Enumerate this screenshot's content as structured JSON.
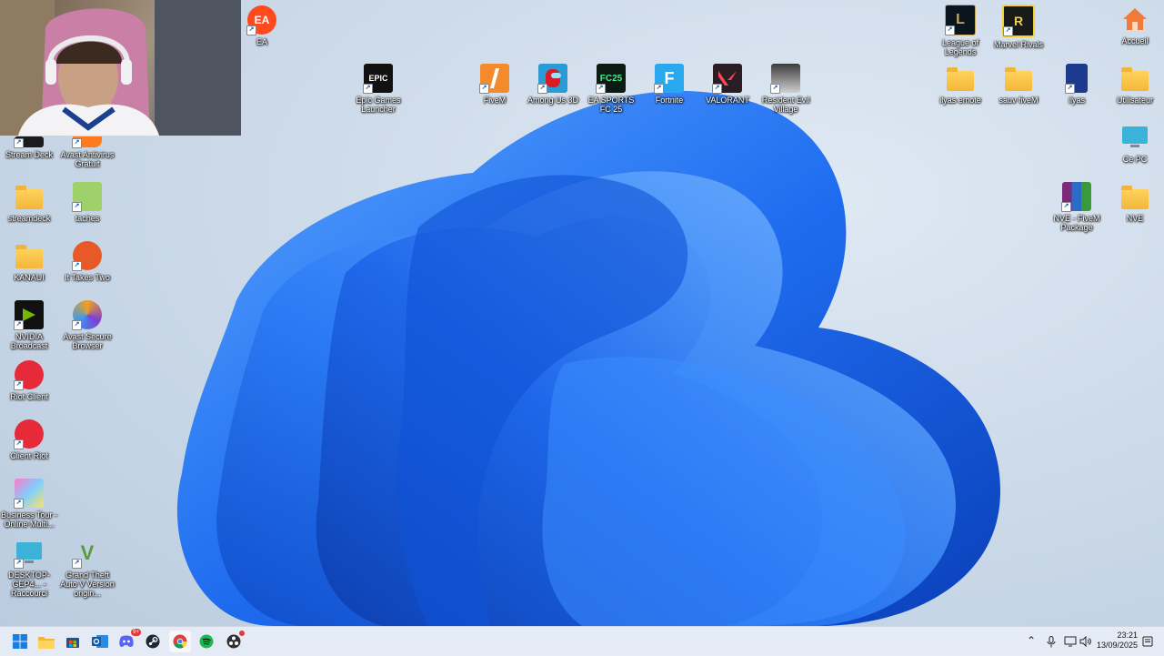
{
  "desktop_icons": {
    "ea": "EA",
    "epic": "Epic Games Launcher",
    "fivem": "FiveM",
    "among_us": "Among Us 3D",
    "fc25": "EA SPORTS FC 25",
    "fortnite": "Fortnite",
    "valorant": "VALORANT",
    "resident_evil": "Resident Evil Village",
    "lol": "League of Legends",
    "marvel": "Marvel Rivals",
    "accueil": "Accueil",
    "ilyas_emote": "ilyas emote",
    "sauv_fivem": "sauv fiveM",
    "ilyas": "ilyas",
    "utilisateur": "Utilisateur",
    "ce_pc": "Ce PC",
    "nve_package": "NVE - FiveM Package",
    "nve": "NVE",
    "stream_deck": "Stream Deck",
    "avast_antivirus": "Avast Antivirus Gratuit",
    "streamdeck": "streamdeck",
    "taches": "taches",
    "kanaui": "KANAUI",
    "it_takes_two": "It Takes Two",
    "nvidia_broadcast": "NVIDIA Broadcast",
    "avast_browser": "Avast Secure Browser",
    "riot_client": "Riot Client",
    "client_riot": "Client Riot",
    "business_tour": "Business Tour - Online Multi...",
    "desktop_shortcut": "DESKTOP-GEP4... - Raccourci",
    "gta": "Grand Theft Auto V Version origin..."
  },
  "taskbar": {
    "discord_badge": "9+",
    "time": "23:21",
    "date": "13/09/2025"
  },
  "icon_glyphs": {
    "ea": "EA",
    "epic": "EPIC",
    "fc25": "FC25",
    "fortnite": "F",
    "gta": "V",
    "shortcut": "↗"
  },
  "colors": {
    "wallpaper_blue": "#1e64e6",
    "taskbar_bg": "#e8eef6",
    "folder_yellow": "#f4b63a"
  }
}
